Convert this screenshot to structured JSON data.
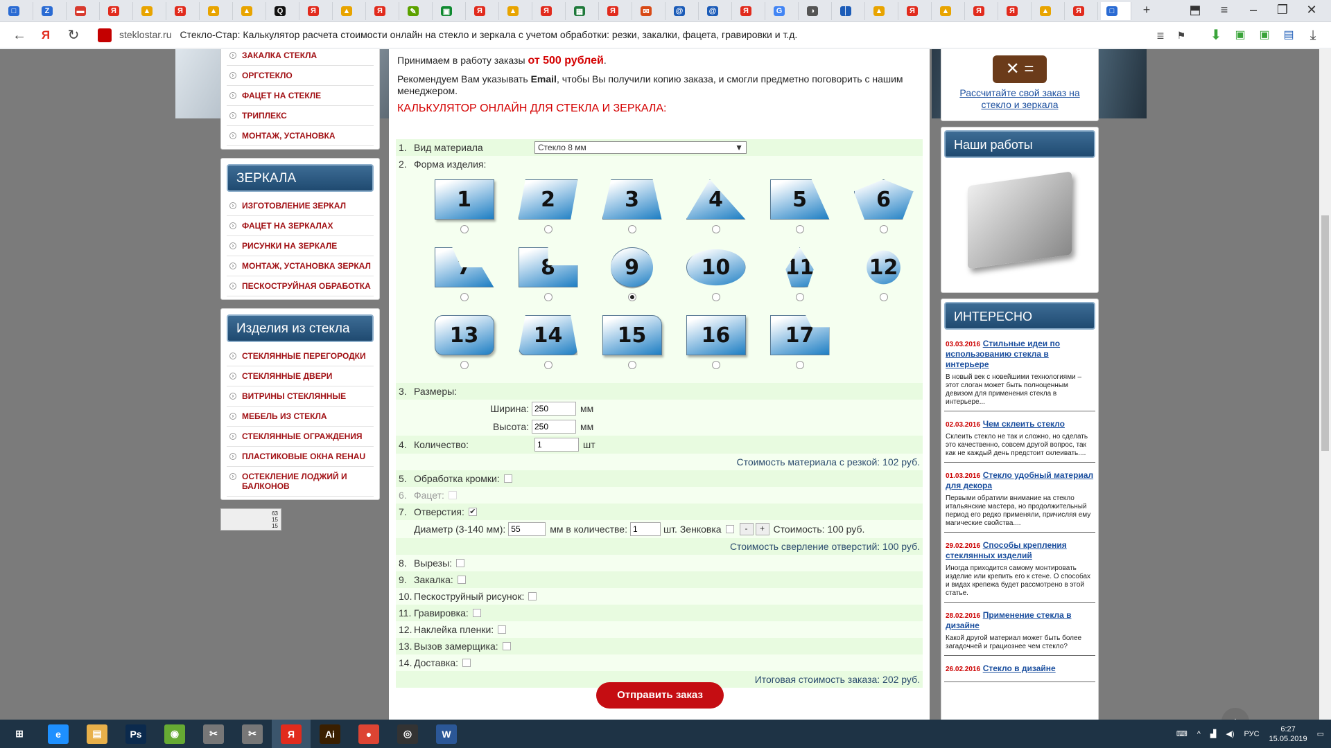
{
  "browser": {
    "tabs": [
      {
        "glyph": "□",
        "color": "#2a6bd3"
      },
      {
        "glyph": "Z",
        "color": "#2a6bd3"
      },
      {
        "glyph": "▬",
        "color": "#d83a2e"
      },
      {
        "glyph": "Я",
        "color": "#e12b1d"
      },
      {
        "glyph": "▲",
        "color": "#e8a400"
      },
      {
        "glyph": "Я",
        "color": "#e12b1d"
      },
      {
        "glyph": "▲",
        "color": "#e8a400"
      },
      {
        "glyph": "▲",
        "color": "#e8a400"
      },
      {
        "glyph": "Q",
        "color": "#111111"
      },
      {
        "glyph": "Я",
        "color": "#e12b1d"
      },
      {
        "glyph": "▲",
        "color": "#e8a400"
      },
      {
        "glyph": "Я",
        "color": "#e12b1d"
      },
      {
        "glyph": "✎",
        "color": "#5ca200"
      },
      {
        "glyph": "▣",
        "color": "#108a31"
      },
      {
        "glyph": "Я",
        "color": "#e12b1d"
      },
      {
        "glyph": "▲",
        "color": "#e8a400"
      },
      {
        "glyph": "Я",
        "color": "#e12b1d"
      },
      {
        "glyph": "▦",
        "color": "#207a3c"
      },
      {
        "glyph": "Я",
        "color": "#e12b1d"
      },
      {
        "glyph": "✉",
        "color": "#d84a17"
      },
      {
        "glyph": "@",
        "color": "#1c5cb8"
      },
      {
        "glyph": "@",
        "color": "#1c5cb8"
      },
      {
        "glyph": "Я",
        "color": "#e12b1d"
      },
      {
        "glyph": "G",
        "color": "#4285f4"
      },
      {
        "glyph": "◑",
        "color": "#555555"
      },
      {
        "glyph": "│",
        "color": "#1c5cb8"
      },
      {
        "glyph": "▲",
        "color": "#e8a400"
      },
      {
        "glyph": "Я",
        "color": "#e12b1d"
      },
      {
        "glyph": "▲",
        "color": "#e8a400"
      },
      {
        "glyph": "Я",
        "color": "#e12b1d"
      },
      {
        "glyph": "Я",
        "color": "#e12b1d"
      },
      {
        "glyph": "▲",
        "color": "#e8a400"
      },
      {
        "glyph": "Я",
        "color": "#e12b1d"
      },
      {
        "glyph": "□",
        "color": "#2a6bd3"
      }
    ],
    "new_tab_label": "+",
    "domain": "steklostar.ru",
    "page_title": "Стекло-Стар: Калькулятор расчета стоимости онлайн на стекло и зеркала с учетом обработки: резки, закалки, фацета, гравировки и т.д."
  },
  "left": {
    "glass_links": [
      "ЗАКАЛКА СТЕКЛА",
      "ОРГСТЕКЛО",
      "ФАЦЕТ НА СТЕКЛЕ",
      "ТРИПЛЕКС",
      "МОНТАЖ, УСТАНОВКА"
    ],
    "mirrors_title": "ЗЕРКАЛА",
    "mirror_links": [
      "ИЗГОТОВЛЕНИЕ ЗЕРКАЛ",
      "ФАЦЕТ НА ЗЕРКАЛАХ",
      "РИСУНКИ НА ЗЕРКАЛЕ",
      "МОНТАЖ, УСТАНОВКА ЗЕРКАЛ",
      "ПЕСКОСТРУЙНАЯ ОБРАБОТКА"
    ],
    "products_title": "Изделия из стекла",
    "product_links": [
      "СТЕКЛЯННЫЕ ПЕРЕГОРОДКИ",
      "СТЕКЛЯННЫЕ ДВЕРИ",
      "ВИТРИНЫ СТЕКЛЯННЫЕ",
      "МЕБЕЛЬ ИЗ СТЕКЛА",
      "СТЕКЛЯННЫЕ ОГРАЖДЕНИЯ",
      "ПЛАСТИКОВЫЕ ОКНА REHAU",
      "ОСТЕКЛЕНИЕ ЛОДЖИЙ И БАЛКОНОВ"
    ],
    "counter": {
      "line1": "63",
      "line2": "15",
      "line3": "15"
    }
  },
  "main": {
    "intro_a": "Принимаем в работу заказы ",
    "intro_b": "от 500 рублей",
    "intro_c": ".",
    "rec_a": "Рекомендуем Вам указывать ",
    "rec_b": "Email",
    "rec_c": ", чтобы Вы получили копию заказа, и смогли предметно поговорить с нашим менеджером.",
    "calc_title": "КАЛЬКУЛЯТОР ОНЛАЙН ДЛЯ СТЕКЛА И ЗЕРКАЛА:",
    "material_label": "Вид материала",
    "material_value": "Стекло 8 мм",
    "shape_label": "Форма изделия:",
    "shapes": [
      "1",
      "2",
      "3",
      "4",
      "5",
      "6",
      "7",
      "8",
      "9",
      "10",
      "11",
      "12",
      "13",
      "14",
      "15",
      "16",
      "17"
    ],
    "selected_shape": "9",
    "sizes_label": "Размеры:",
    "width_label": "Ширина:",
    "width_value": "250",
    "width_unit": "мм",
    "height_label": "Высота:",
    "height_value": "250",
    "height_unit": "мм",
    "qty_label": "Количество:",
    "qty_value": "1",
    "qty_unit": "шт",
    "material_cost": "Стоимость материала с резкой: 102 руб.",
    "edge_label": "Обработка кромки:",
    "facet_label": "Фацет:",
    "holes_label": "Отверстия:",
    "diam_label": "Диаметр (3-140 мм):",
    "diam_value": "55",
    "count_label": "мм в количестве:",
    "count_value": "1",
    "countersink_label": "шт. Зенковка",
    "minus": "-",
    "plus": "+",
    "hole_cost": "Стоимость: 100 руб.",
    "drill_cost": "Стоимость сверление отверстий: 100 руб.",
    "cutouts_label": "Вырезы:",
    "temper_label": "Закалка:",
    "sandblast_label": "Пескоструйный рисунок:",
    "engrave_label": "Гравировка:",
    "film_label": "Наклейка пленки:",
    "measurer_label": "Вызов замерщика:",
    "delivery_label": "Доставка:",
    "total": "Итоговая стоимость заказа: 202 руб.",
    "submit": "Отправить заказ",
    "nums": [
      "1.",
      "2.",
      "3.",
      "4.",
      "5.",
      "6.",
      "7.",
      "8.",
      "9.",
      "10.",
      "11.",
      "12.",
      "13.",
      "14."
    ]
  },
  "right": {
    "calc_link": "Рассчитайте свой заказ на стекло и зеркала",
    "works_title": "Наши работы",
    "interesting_title": "ИНТЕРЕСНО",
    "news": [
      {
        "date": "03.03.2016",
        "title": "Стильные идеи по использованию стекла в интерьере",
        "text": "В новый век с новейшими технологиями – этот слоган может быть полноценным девизом для применения стекла в интерьере..."
      },
      {
        "date": "02.03.2016",
        "title": "Чем склеить стекло",
        "text": "Склеить стекло не так и сложно, но сделать это качественно, совсем другой вопрос, так как не каждый день предстоит склеивать...."
      },
      {
        "date": "01.03.2016",
        "title": "Стекло удобный материал для декора",
        "text": "Первыми обратили внимание на стекло итальянские мастера, но продолжительный период его редко применяли, причисляя ему магические свойства...."
      },
      {
        "date": "29.02.2016",
        "title": "Способы крепления стеклянных изделий",
        "text": "Иногда приходится самому монтировать изделие или крепить его к стене. О способах и видах крепежа будет рассмотрено в этой статье."
      },
      {
        "date": "28.02.2016",
        "title": "Применение стекла в дизайне",
        "text": "Какой другой материал может быть более загадочней и грациознее чем стекло?"
      },
      {
        "date": "26.02.2016",
        "title": "Стекло в дизайне",
        "text": ""
      }
    ]
  },
  "taskbar": {
    "apps": [
      {
        "label": "e",
        "color": "#1e90ff"
      },
      {
        "label": "▤",
        "color": "#e8b04a"
      },
      {
        "label": "Ps",
        "color": "#0b2a4d"
      },
      {
        "label": "◉",
        "color": "#66aa33"
      },
      {
        "label": "✂",
        "color": "#777777"
      },
      {
        "label": "✂",
        "color": "#777777"
      },
      {
        "label": "Я",
        "color": "#e12b1d"
      },
      {
        "label": "Ai",
        "color": "#3a1f00"
      },
      {
        "label": "●",
        "color": "#dd4433"
      },
      {
        "label": "◎",
        "color": "#333333"
      },
      {
        "label": "W",
        "color": "#2b5797"
      }
    ],
    "lang": "РУС",
    "time": "6:27",
    "date": "15.05.2019"
  }
}
